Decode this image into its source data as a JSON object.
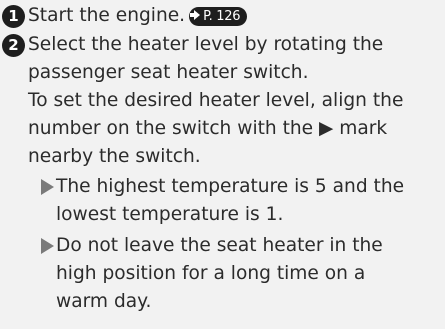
{
  "steps": [
    {
      "number": "1",
      "text": "Start the engine.",
      "reference": "P. 126"
    },
    {
      "number": "2",
      "lines": [
        "Select the heater level by rotating the",
        "passenger seat heater switch.",
        "To set the desired heater level, align the",
        "number on the switch with the ▶ mark",
        "nearby the switch."
      ]
    }
  ],
  "notes": [
    {
      "lines": [
        "The highest temperature is 5 and the",
        "lowest temperature is 1."
      ]
    },
    {
      "lines": [
        "Do not leave the seat heater in the",
        "high position for a long time on a",
        "warm day."
      ]
    }
  ]
}
